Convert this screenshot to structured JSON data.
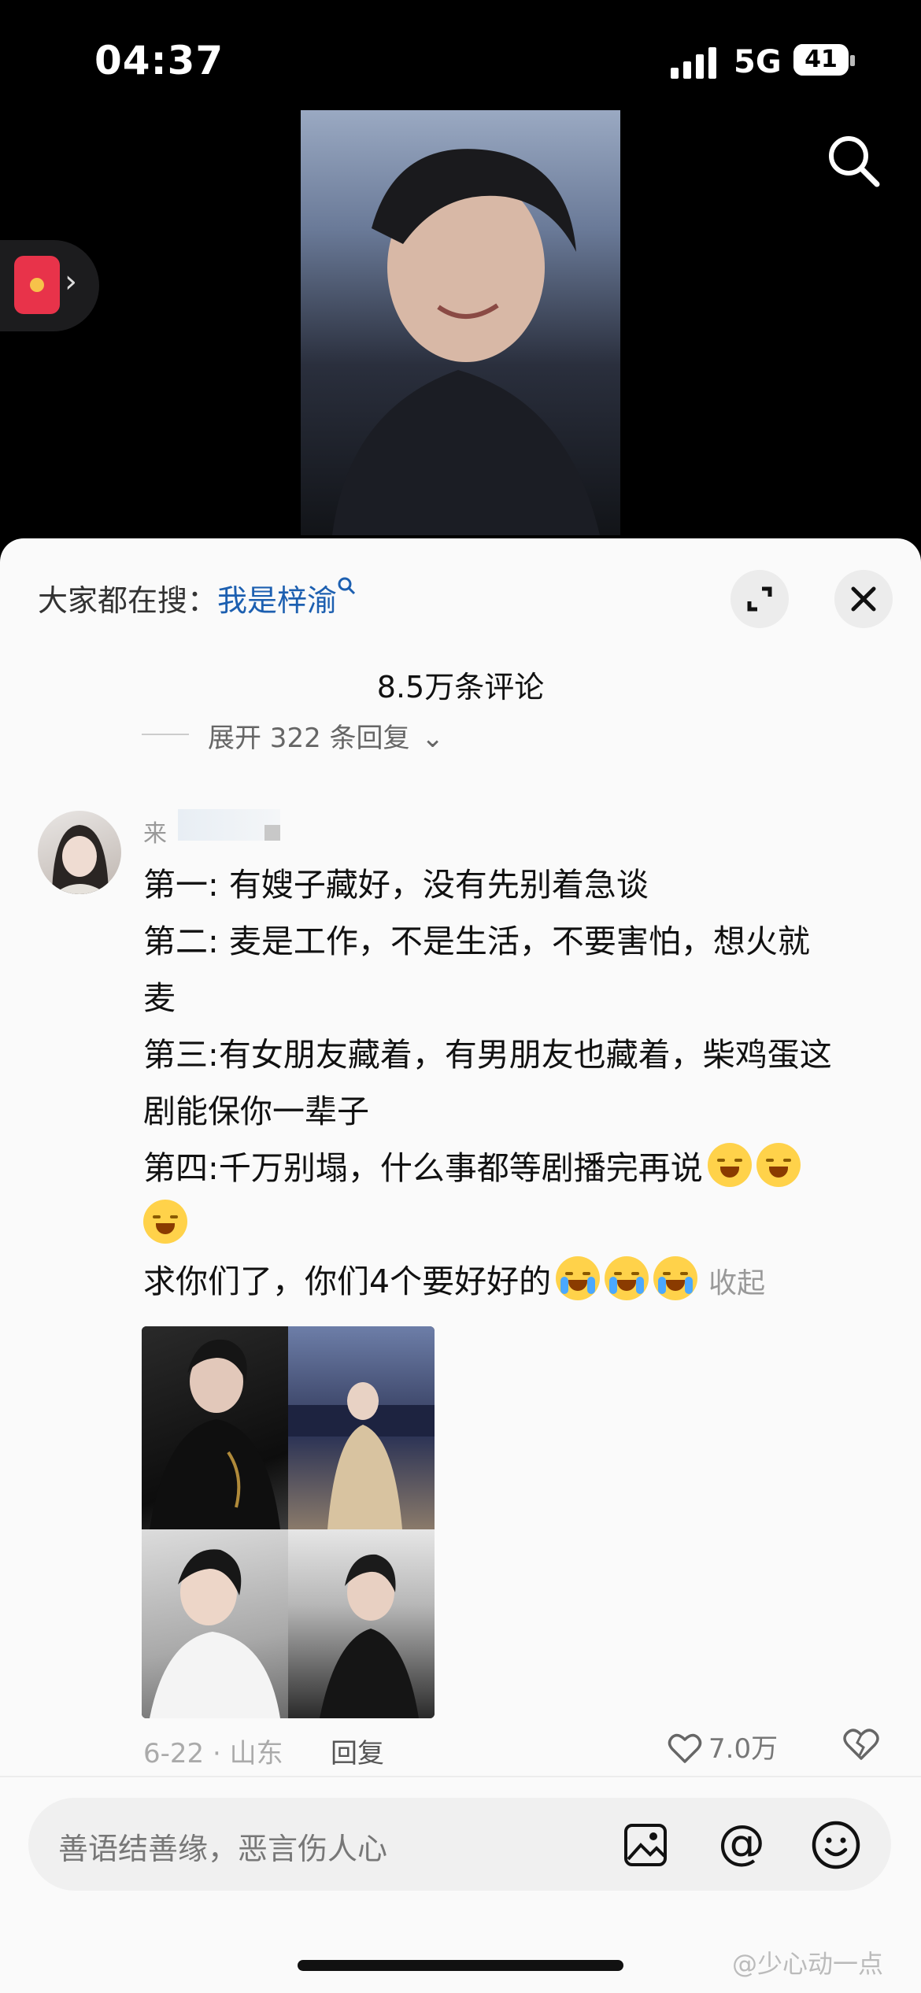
{
  "status_bar": {
    "time": "04:37",
    "network": "5G",
    "battery": "41",
    "battery_percent": 41
  },
  "sheet": {
    "trending_prefix": "大家都在搜：",
    "trending_term": "我是梓渝",
    "comment_count": "8.5万条评论",
    "expand_replies": "展开 322 条回复",
    "chevron": "⌄"
  },
  "comment": {
    "username": "来",
    "lines": [
      "第一: 有嫂子藏好，没有先别着急谈",
      "第二: 麦是工作，不是生活，不要害怕，想火就",
      "麦",
      "第三:有女朋友藏着，有男朋友也藏着，柴鸡蛋这",
      "剧能保你一辈子",
      "第四:千万别塌，什么事都等剧播完再说",
      "",
      "求你们了，你们4个要好好的"
    ],
    "collapse": "收起",
    "date_location": "6-22 · 山东",
    "reply": "回复",
    "likes": "7.0万"
  },
  "input": {
    "placeholder": "善语结善缘，恶言伤人心",
    "at_symbol": "@"
  },
  "watermark": "@少心动一点",
  "icons": {
    "search": "search-icon",
    "expand": "expand-icon",
    "close": "close-icon",
    "like": "heart-icon",
    "dislike": "broken-heart-icon",
    "image": "image-icon",
    "emoji": "emoji-icon",
    "red_packet": "red-packet-icon"
  },
  "colors": {
    "link": "#1c5fb0",
    "sheet_bg": "#fafafa",
    "red_packet": "#e8334a"
  }
}
